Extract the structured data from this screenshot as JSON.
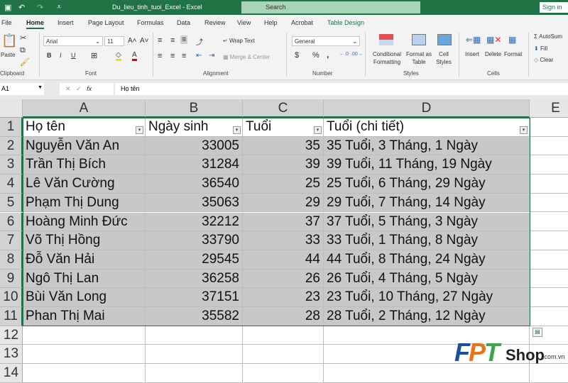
{
  "titlebar": {
    "title": "Du_lieu_tinh_tuoi_Excel  -  Excel",
    "search": "Search",
    "signin": "Sign in"
  },
  "tabs": [
    "File",
    "Home",
    "Insert",
    "Page Layout",
    "Formulas",
    "Data",
    "Review",
    "View",
    "Help",
    "Acrobat",
    "Table Design"
  ],
  "ribbon": {
    "paste": "Paste",
    "clipboard": "Clipboard",
    "font_name": "Arial",
    "font_size": "11",
    "font": "Font",
    "bold": "B",
    "italic": "I",
    "underline": "U",
    "wrap_text": "Wrap Text",
    "merge_center": "Merge & Center",
    "alignment": "Alignment",
    "number_format": "General",
    "currency": "$",
    "percent": "%",
    "comma": ",",
    "number": "Number",
    "conditional_formatting": "Conditional Formatting",
    "format_as_table": "Format as Table",
    "cell_styles": "Cell Styles",
    "styles": "Styles",
    "insert": "Insert",
    "delete": "Delete",
    "format": "Format",
    "cells": "Cells",
    "autosum": "AutoSum",
    "fill": "Fill",
    "clear": "Clear"
  },
  "formula_bar": {
    "name_box": "A1",
    "fx": "fx",
    "formula": "Họ tên"
  },
  "columns": [
    "A",
    "B",
    "C",
    "D",
    "E"
  ],
  "rows": [
    "1",
    "2",
    "3",
    "4",
    "5",
    "6",
    "7",
    "8",
    "9",
    "10",
    "11",
    "12",
    "13",
    "14"
  ],
  "headers": [
    "Họ tên",
    "Ngày sinh",
    "Tuổi",
    "Tuổi (chi tiết)"
  ],
  "table": [
    [
      "Nguyễn Văn An",
      "33005",
      "35",
      "35 Tuổi, 3 Tháng, 1 Ngày"
    ],
    [
      "Trần Thị Bích",
      "31284",
      "39",
      "39 Tuổi, 11 Tháng, 19 Ngày"
    ],
    [
      "Lê Văn Cường",
      "36540",
      "25",
      "25 Tuổi, 6 Tháng, 29 Ngày"
    ],
    [
      "Phạm Thị Dung",
      "35063",
      "29",
      "29 Tuổi, 7 Tháng, 14 Ngày"
    ],
    [
      "Hoàng Minh Đức",
      "32212",
      "37",
      "37 Tuổi, 5 Tháng, 3 Ngày"
    ],
    [
      "Võ Thị Hồng",
      "33790",
      "33",
      "33 Tuổi, 1 Tháng, 8 Ngày"
    ],
    [
      "Đỗ Văn Hải",
      "29545",
      "44",
      "44 Tuổi, 8 Tháng, 24 Ngày"
    ],
    [
      "Ngô Thị Lan",
      "36258",
      "26",
      "26 Tuổi, 4 Tháng, 5 Ngày"
    ],
    [
      "Bùi Văn Long",
      "37151",
      "23",
      "23 Tuổi, 10 Tháng, 27 Ngày"
    ],
    [
      "Phan Thị Mai",
      "35582",
      "28",
      "28 Tuổi, 2 Tháng, 12 Ngày"
    ]
  ],
  "logo": {
    "fpt": "FPT",
    "shop": "Shop",
    ".com.vn": ".com.vn"
  }
}
